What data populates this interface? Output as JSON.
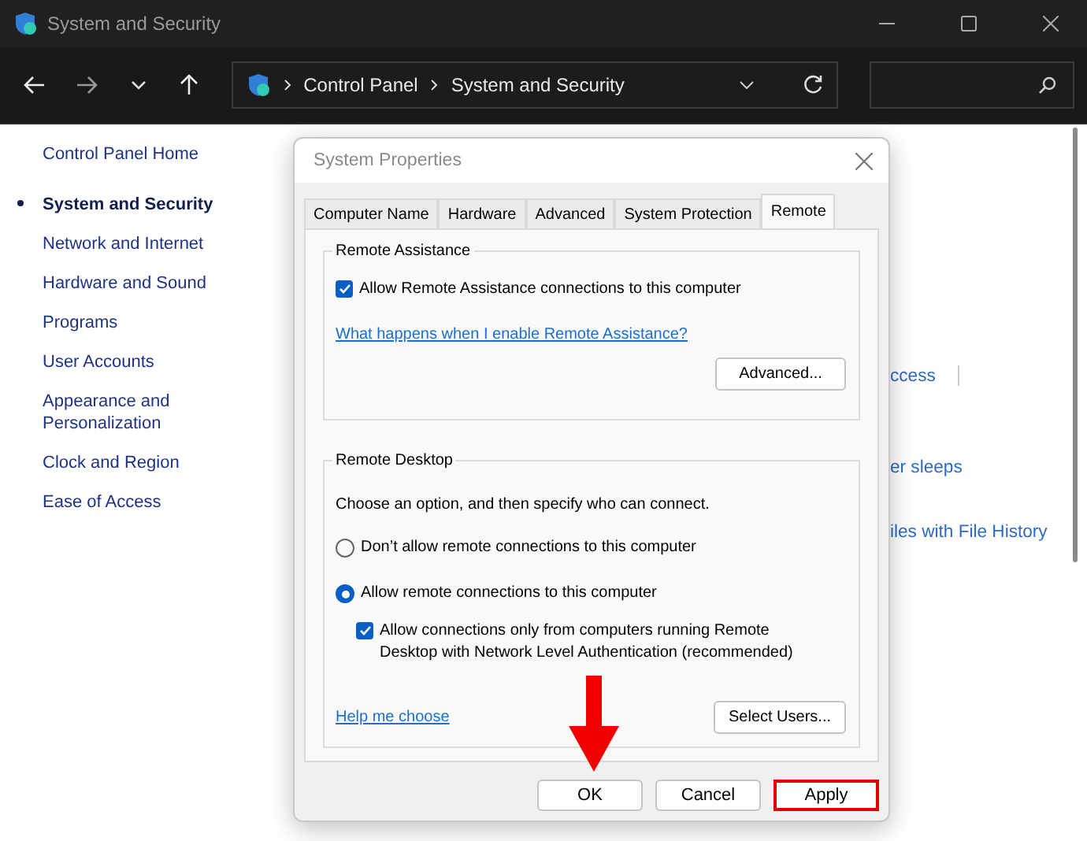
{
  "window": {
    "title": "System and Security"
  },
  "address_bar": {
    "breadcrumb": [
      "Control Panel",
      "System and Security"
    ]
  },
  "sidebar": {
    "home": "Control Panel Home",
    "items": [
      {
        "label": "System and Security",
        "selected": true
      },
      {
        "label": "Network and Internet",
        "selected": false
      },
      {
        "label": "Hardware and Sound",
        "selected": false
      },
      {
        "label": "Programs",
        "selected": false
      },
      {
        "label": "User Accounts",
        "selected": false
      },
      {
        "label": "Appearance and Personalization",
        "selected": false
      },
      {
        "label": "Clock and Region",
        "selected": false
      },
      {
        "label": "Ease of Access",
        "selected": false
      }
    ]
  },
  "content_links": [
    "ccess",
    "er sleeps",
    "iles with File History"
  ],
  "dialog": {
    "title": "System Properties",
    "tabs": [
      {
        "label": "Computer Name",
        "selected": false
      },
      {
        "label": "Hardware",
        "selected": false
      },
      {
        "label": "Advanced",
        "selected": false
      },
      {
        "label": "System Protection",
        "selected": false
      },
      {
        "label": "Remote",
        "selected": true
      }
    ],
    "remote_assistance": {
      "title": "Remote Assistance",
      "checkbox": {
        "label": "Allow Remote Assistance connections to this computer",
        "checked": true
      },
      "link": "What happens when I enable Remote Assistance?",
      "button": "Advanced..."
    },
    "remote_desktop": {
      "title": "Remote Desktop",
      "intro": "Choose an option, and then specify who can connect.",
      "options": [
        {
          "label": "Don’t allow remote connections to this computer",
          "selected": false
        },
        {
          "label": "Allow remote connections to this computer",
          "selected": true
        }
      ],
      "nla": {
        "label": "Allow connections only from computers running Remote Desktop with Network Level Authentication (recommended)",
        "checked": true
      },
      "link": "Help me choose",
      "button": "Select Users..."
    },
    "buttons": [
      {
        "label": "OK",
        "highlighted": false
      },
      {
        "label": "Cancel",
        "highlighted": false
      },
      {
        "label": "Apply",
        "highlighted": true
      }
    ]
  }
}
